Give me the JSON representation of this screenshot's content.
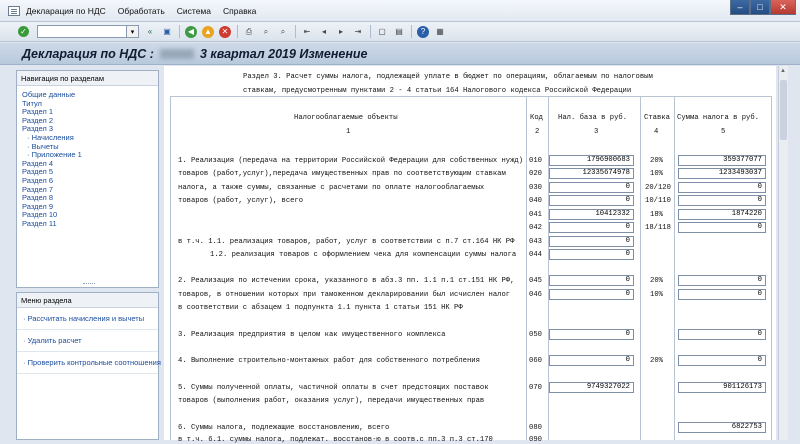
{
  "menu": {
    "items": [
      "Декларация по НДС",
      "Обработать",
      "Система",
      "Справка"
    ]
  },
  "toolbar": {
    "icons": [
      "check-icon",
      "command-input",
      "back-icon",
      "save-icon",
      "cancel-icon",
      "exit-icon",
      "print-icon",
      "find-icon",
      "help-icon"
    ]
  },
  "title": {
    "prefix": "Декларация по НДС :",
    "suffix": "3 квартал 2019 Изменение"
  },
  "nav": {
    "header": "Навигация по разделам",
    "items": [
      "Общие данные",
      "Титул",
      "Раздел 1",
      "Раздел 2",
      "Раздел 3",
      "Начисления",
      "Вычеты",
      "Приложение 1",
      "Раздел 4",
      "Раздел 5",
      "Раздел 6",
      "Раздел 7",
      "Раздел 8",
      "Раздел 9",
      "Раздел 10",
      "Раздел 11"
    ]
  },
  "menu_panel": {
    "header": "Меню раздела",
    "items": [
      "Рассчитать начисления и вычеты",
      "Удалить расчет",
      "Проверить контрольные соотношения"
    ]
  },
  "form": {
    "heading1": "Раздел 3. Расчет суммы налога, подлежащей уплате в бюджет по операциям, облагаемым по налоговым",
    "heading2": "ставкам, предусмотренным пунктами 2 - 4 статьи 164 Налогового кодекса Российской Федерации",
    "columns": [
      "Налогооблагаемые объекты",
      "Код",
      "Нал. база в руб.",
      "Ставка",
      "Сумма налога в руб."
    ],
    "column_numbers": [
      "1",
      "2",
      "3",
      "4",
      "5"
    ],
    "rows": [
      {
        "text": "1. Реализация (передача на территории Российской Федерации для собственных нужд)",
        "code": "010",
        "base": "1796900683",
        "rate": "20%",
        "tax": "359377077"
      },
      {
        "text": "товаров (работ,услуг),передача имущественных прав по соответствующим ставкам",
        "code": "020",
        "base": "12335674978",
        "rate": "10%",
        "tax": "1233493037"
      },
      {
        "text": "налога, а также суммы, связанные с расчетами по оплате налогооблагаемых",
        "code": "030",
        "base": "0",
        "rate": "20/120",
        "tax": "0"
      },
      {
        "text": "товаров (работ, услуг), всего",
        "code": "040",
        "base": "0",
        "rate": "10/110",
        "tax": "0"
      },
      {
        "text": "",
        "code": "041",
        "base": "10412332",
        "rate": "18%",
        "tax": "1874220"
      },
      {
        "text": "",
        "code": "042",
        "base": "0",
        "rate": "18/118",
        "tax": "0"
      },
      {
        "text": "в т.ч. 1.1. реализация товаров, работ, услуг в соответствии с п.7 ст.164 НК РФ",
        "code": "043",
        "base": "0",
        "rate": "",
        "tax": ""
      },
      {
        "text": "1.2. реализация товаров с оформлением чека для компенсации суммы налога",
        "code": "044",
        "base": "0",
        "rate": "",
        "tax": ""
      },
      {
        "text": "2. Реализация по истечении срока, указанного в абз.3 пп. 1.1 п.1 ст.151 НК РФ,",
        "code": "045",
        "base": "0",
        "rate": "20%",
        "tax": "0"
      },
      {
        "text": "товаров, в отношении которых при таможенном декларировании был исчислен налог",
        "code": "046",
        "base": "0",
        "rate": "10%",
        "tax": "0"
      },
      {
        "text": "в соответствии с абзацем 1 подпункта 1.1 пункта 1 статьи 151 НК РФ",
        "code": "",
        "base": "",
        "rate": "",
        "tax": ""
      },
      {
        "text": "3. Реализация предприятия в целом как имущественного комплекса",
        "code": "050",
        "base": "0",
        "rate": "",
        "tax": "0"
      },
      {
        "text": "4. Выполнение строительно-монтажных работ для собственного потребления",
        "code": "060",
        "base": "0",
        "rate": "20%",
        "tax": "0"
      },
      {
        "text": "5. Суммы полученной оплаты, частичной оплаты в счет предстоящих поставок",
        "code": "070",
        "base": "9749327022",
        "rate": "",
        "tax": "901126173"
      },
      {
        "text": "товаров (выполнения работ, оказания услуг), передачи имущественных прав",
        "code": "",
        "base": "",
        "rate": "",
        "tax": ""
      },
      {
        "text": "6. Суммы налога, подлежащие восстановлению, всего",
        "code": "080",
        "base": "",
        "rate": "",
        "tax": "6822753"
      },
      {
        "text": "в т.ч. 6.1. суммы налога, подлежат. восстанов-ю в соотв.с пп.3 п.3 ст.170",
        "code": "090",
        "base": "",
        "rate": "",
        "tax": ""
      }
    ]
  }
}
